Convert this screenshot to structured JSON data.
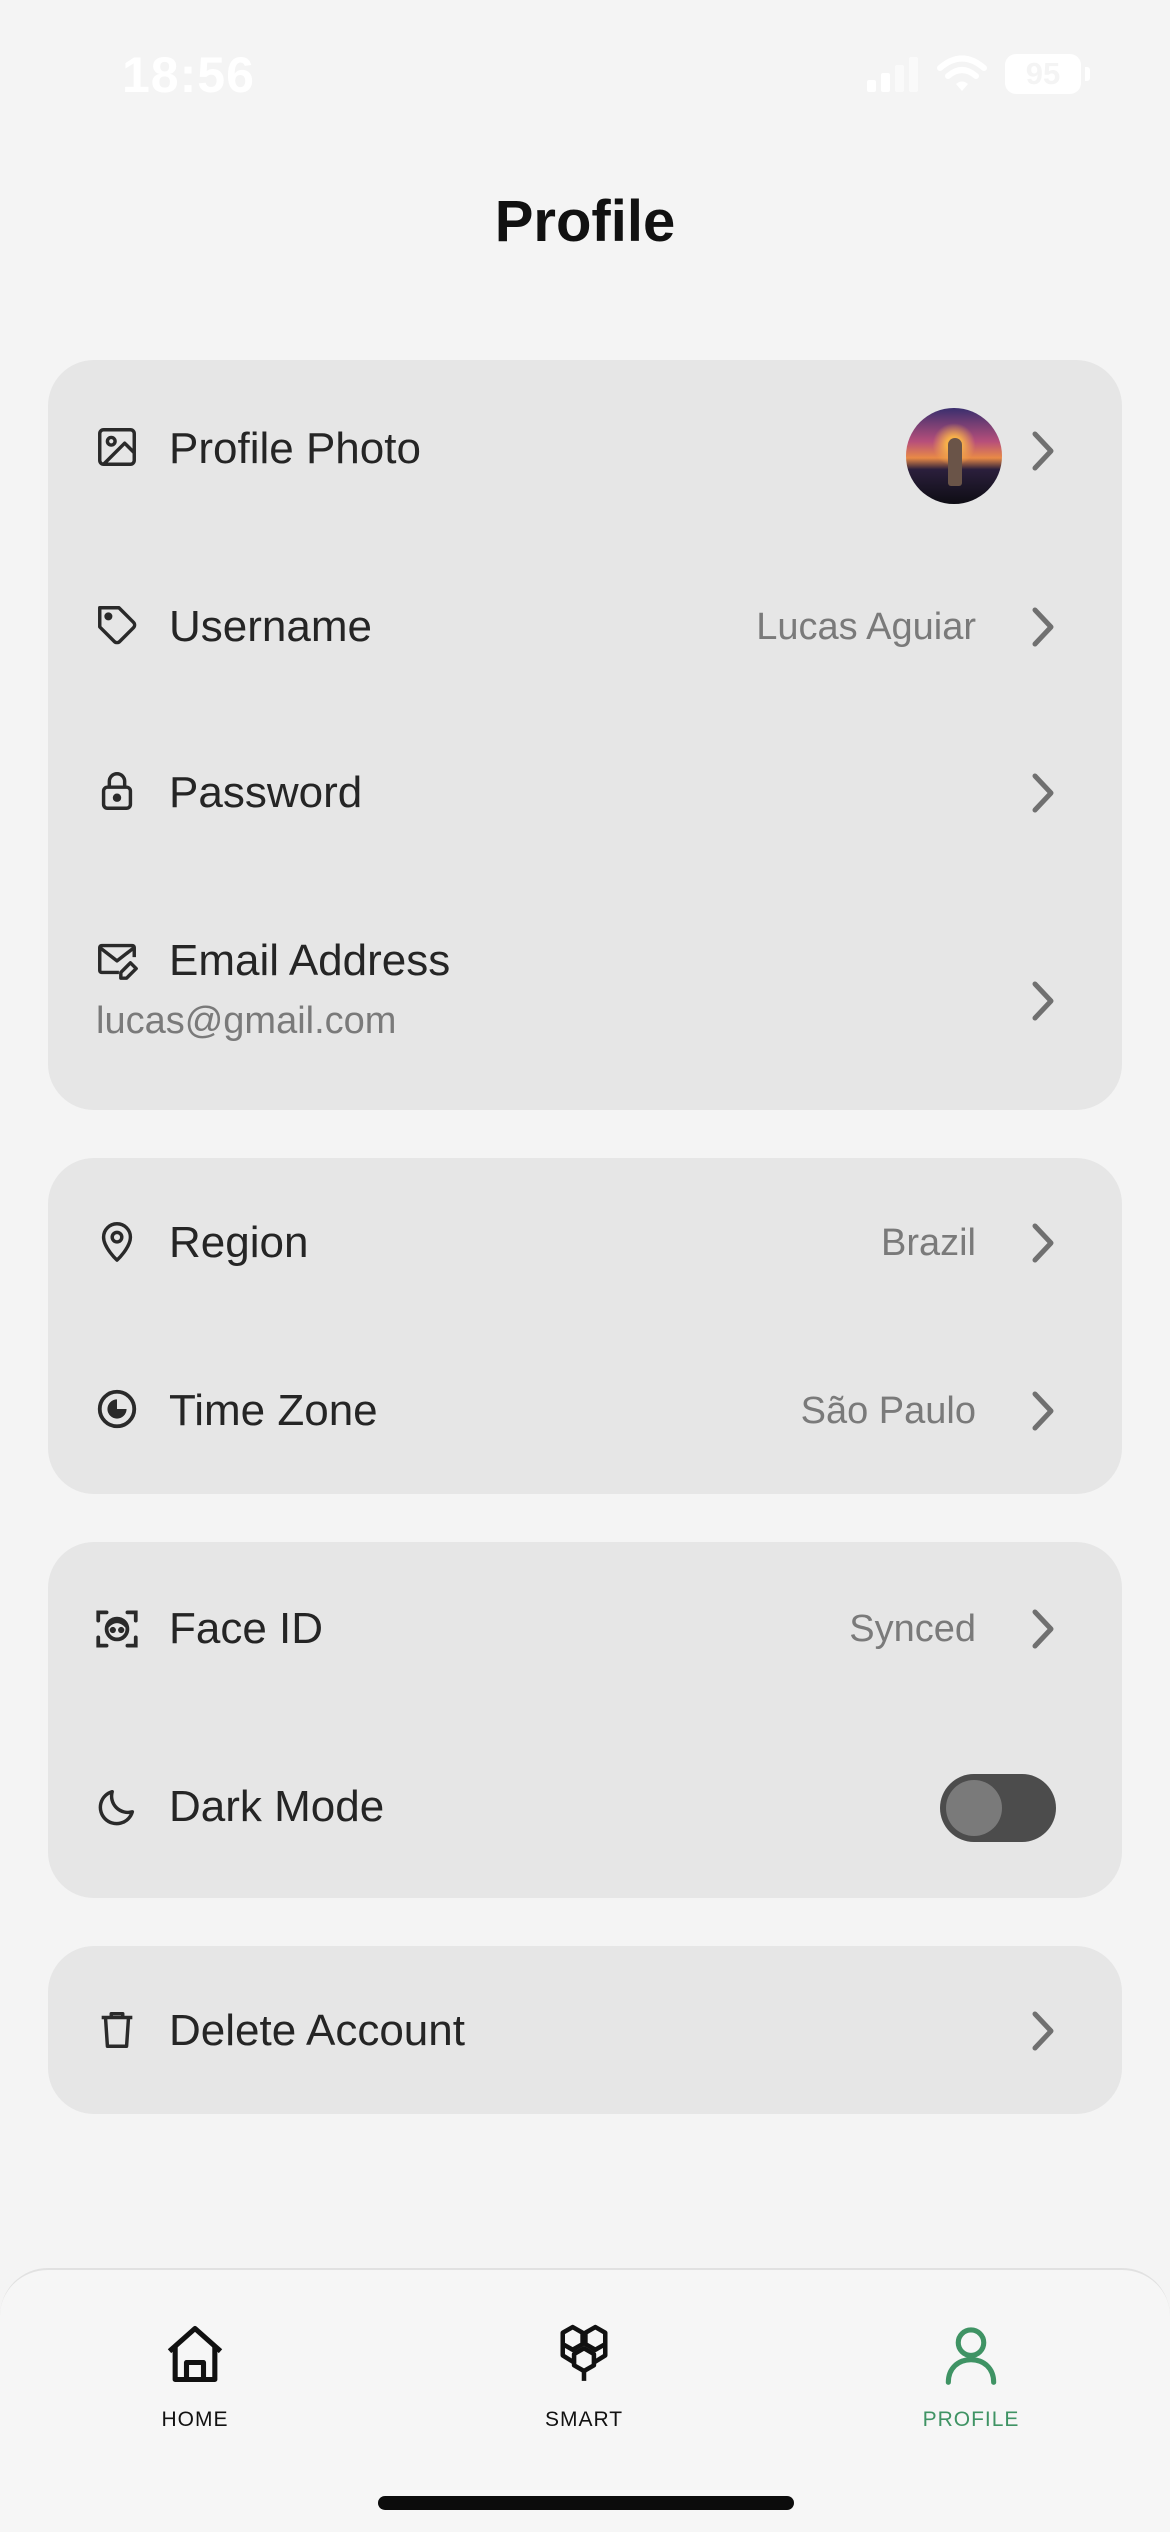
{
  "status_bar": {
    "time": "18:56",
    "battery": "95"
  },
  "page": {
    "title": "Profile"
  },
  "account": {
    "profile_photo": {
      "label": "Profile Photo"
    },
    "username": {
      "label": "Username",
      "value": "Lucas Aguiar"
    },
    "password": {
      "label": "Password"
    },
    "email": {
      "label": "Email Address",
      "value": "lucas@gmail.com"
    }
  },
  "location": {
    "region": {
      "label": "Region",
      "value": "Brazil"
    },
    "time_zone": {
      "label": "Time Zone",
      "value": "São Paulo"
    }
  },
  "security": {
    "face_id": {
      "label": "Face ID",
      "value": "Synced"
    },
    "dark_mode": {
      "label": "Dark Mode",
      "enabled": false
    }
  },
  "danger": {
    "delete_account": {
      "label": "Delete Account"
    }
  },
  "tabs": [
    {
      "label": "HOME",
      "icon": "home-icon",
      "active": false
    },
    {
      "label": "SMART",
      "icon": "smart-hexagons-icon",
      "active": false
    },
    {
      "label": "PROFILE",
      "icon": "profile-icon",
      "active": true
    }
  ],
  "colors": {
    "accent": "#3f9364",
    "card": "#e6e6e6",
    "background": "#f4f4f4"
  }
}
